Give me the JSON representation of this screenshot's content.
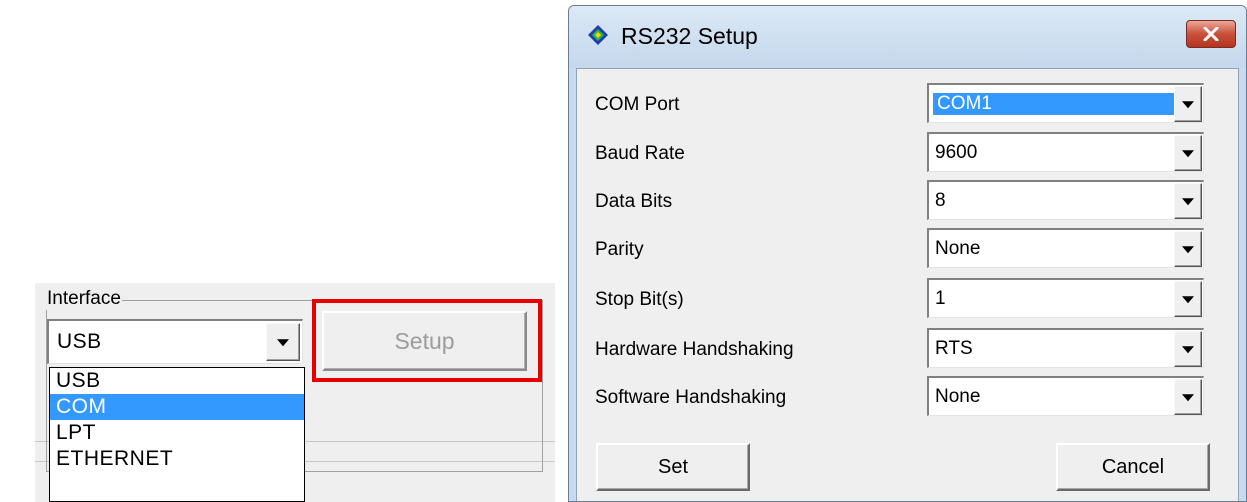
{
  "interface": {
    "label": "Interface",
    "selected": "USB",
    "options": [
      "USB",
      "COM",
      "LPT",
      "ETHERNET"
    ],
    "highlighted": "COM",
    "setup_label": "Setup",
    "highlight_color": "#e60000"
  },
  "dialog": {
    "title": "RS232 Setup",
    "fields": [
      {
        "label": "COM Port",
        "value": "COM1"
      },
      {
        "label": "Baud Rate",
        "value": "9600"
      },
      {
        "label": "Data Bits",
        "value": "8"
      },
      {
        "label": "Parity",
        "value": "None"
      },
      {
        "label": "Stop Bit(s)",
        "value": "1"
      },
      {
        "label": "Hardware Handshaking",
        "value": "RTS"
      },
      {
        "label": "Software Handshaking",
        "value": "None"
      }
    ],
    "set_label": "Set",
    "cancel_label": "Cancel",
    "icons": {
      "app": "diamond-app-icon",
      "close": "close-icon",
      "dropdown": "chevron-down-icon"
    },
    "colors": {
      "selection": "#3399ff",
      "close": "#c9503a",
      "frame": "#c8daee"
    }
  }
}
